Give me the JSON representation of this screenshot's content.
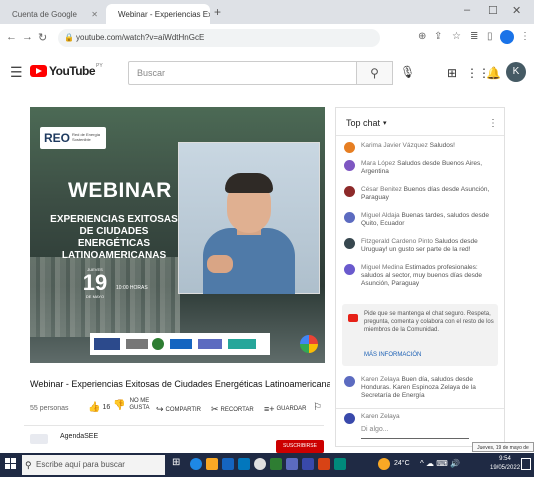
{
  "browser": {
    "tabs": [
      {
        "label": "Cuenta de Google"
      },
      {
        "label": "Webinar - Experiencias Ex"
      }
    ],
    "url": "youtube.com/watch?v=aiWdtHnGcE"
  },
  "youtube": {
    "logo_text": "YouTube",
    "logo_region": "PY",
    "search_placeholder": "Buscar",
    "avatar_letter": "K"
  },
  "video": {
    "banner_org": "REO",
    "banner_org_sub": "Red de Energía Sostenible",
    "headline_1": "WEBINAR",
    "headline_2": "EXPERIENCIAS EXITOSAS DE CIUDADES ENERGÉTICAS LATINOAMERICANAS",
    "date_label": "JUEVES",
    "date_day": "19",
    "date_month": "DE MAYO",
    "date_time": "10:00 HORAS",
    "title": "Webinar - Experiencias Exitosas de Ciudades Energéticas Latinoamericanas",
    "viewers": "55 personas",
    "likes": "16",
    "dislike_label": "NO ME GUSTA",
    "share_label": "COMPARTIR",
    "clip_label": "RECORTAR",
    "save_label": "GUARDAR",
    "channel_name": "AgendaSEE",
    "subscribe_label": "SUSCRIBIRSE"
  },
  "chat": {
    "header": "Top chat",
    "messages": [
      {
        "author": "Karima Javier Vázquez",
        "text": "Saludos!",
        "color": "#e67e22"
      },
      {
        "author": "Mara López",
        "text": "Saludos desde Buenos Aires, Argentina",
        "color": "#7e57c2"
      },
      {
        "author": "César Benitez",
        "text": "Buenos días desde Asunción, Paraguay",
        "color": "#8d2a2a"
      },
      {
        "author": "Miguel Aldaja",
        "text": "Buenas tardes, saludos desde Quito, Ecuador",
        "color": "#5c6bc0"
      },
      {
        "author": "Fitzgerald Cardeno Pinto",
        "text": "Saludos desde Uruguay! un gusto ser parte de la red!",
        "color": "#37474f"
      },
      {
        "author": "Miguel Medina",
        "text": "Estimados profesionales: saludos al sector, muy buenos días desde Asunción, Paraguay",
        "color": "#6a5acd"
      }
    ],
    "notice_text": "Pide que se mantenga el chat seguro. Respeta, pregunta, comenta y colabora con el resto de los miembros de la Comunidad.",
    "notice_link": "MÁS INFORMACIÓN",
    "late_messages": [
      {
        "author": "Karen Zelaya",
        "text": "Buen día, saludos desde Honduras. Karen Espinoza Zelaya de la Secretaría de Energía",
        "color": "#5c6bc0"
      },
      {
        "author": "Karen Zelaya",
        "text": "",
        "color": "#3949ab"
      }
    ],
    "input_placeholder": "Di algo..."
  },
  "taskbar": {
    "search_placeholder": "Escribe aquí para buscar",
    "weather": "24°C",
    "time": "9:54",
    "date": "19/05/2022",
    "tooltip": "Jueves, 19 de mayo de 2022"
  }
}
